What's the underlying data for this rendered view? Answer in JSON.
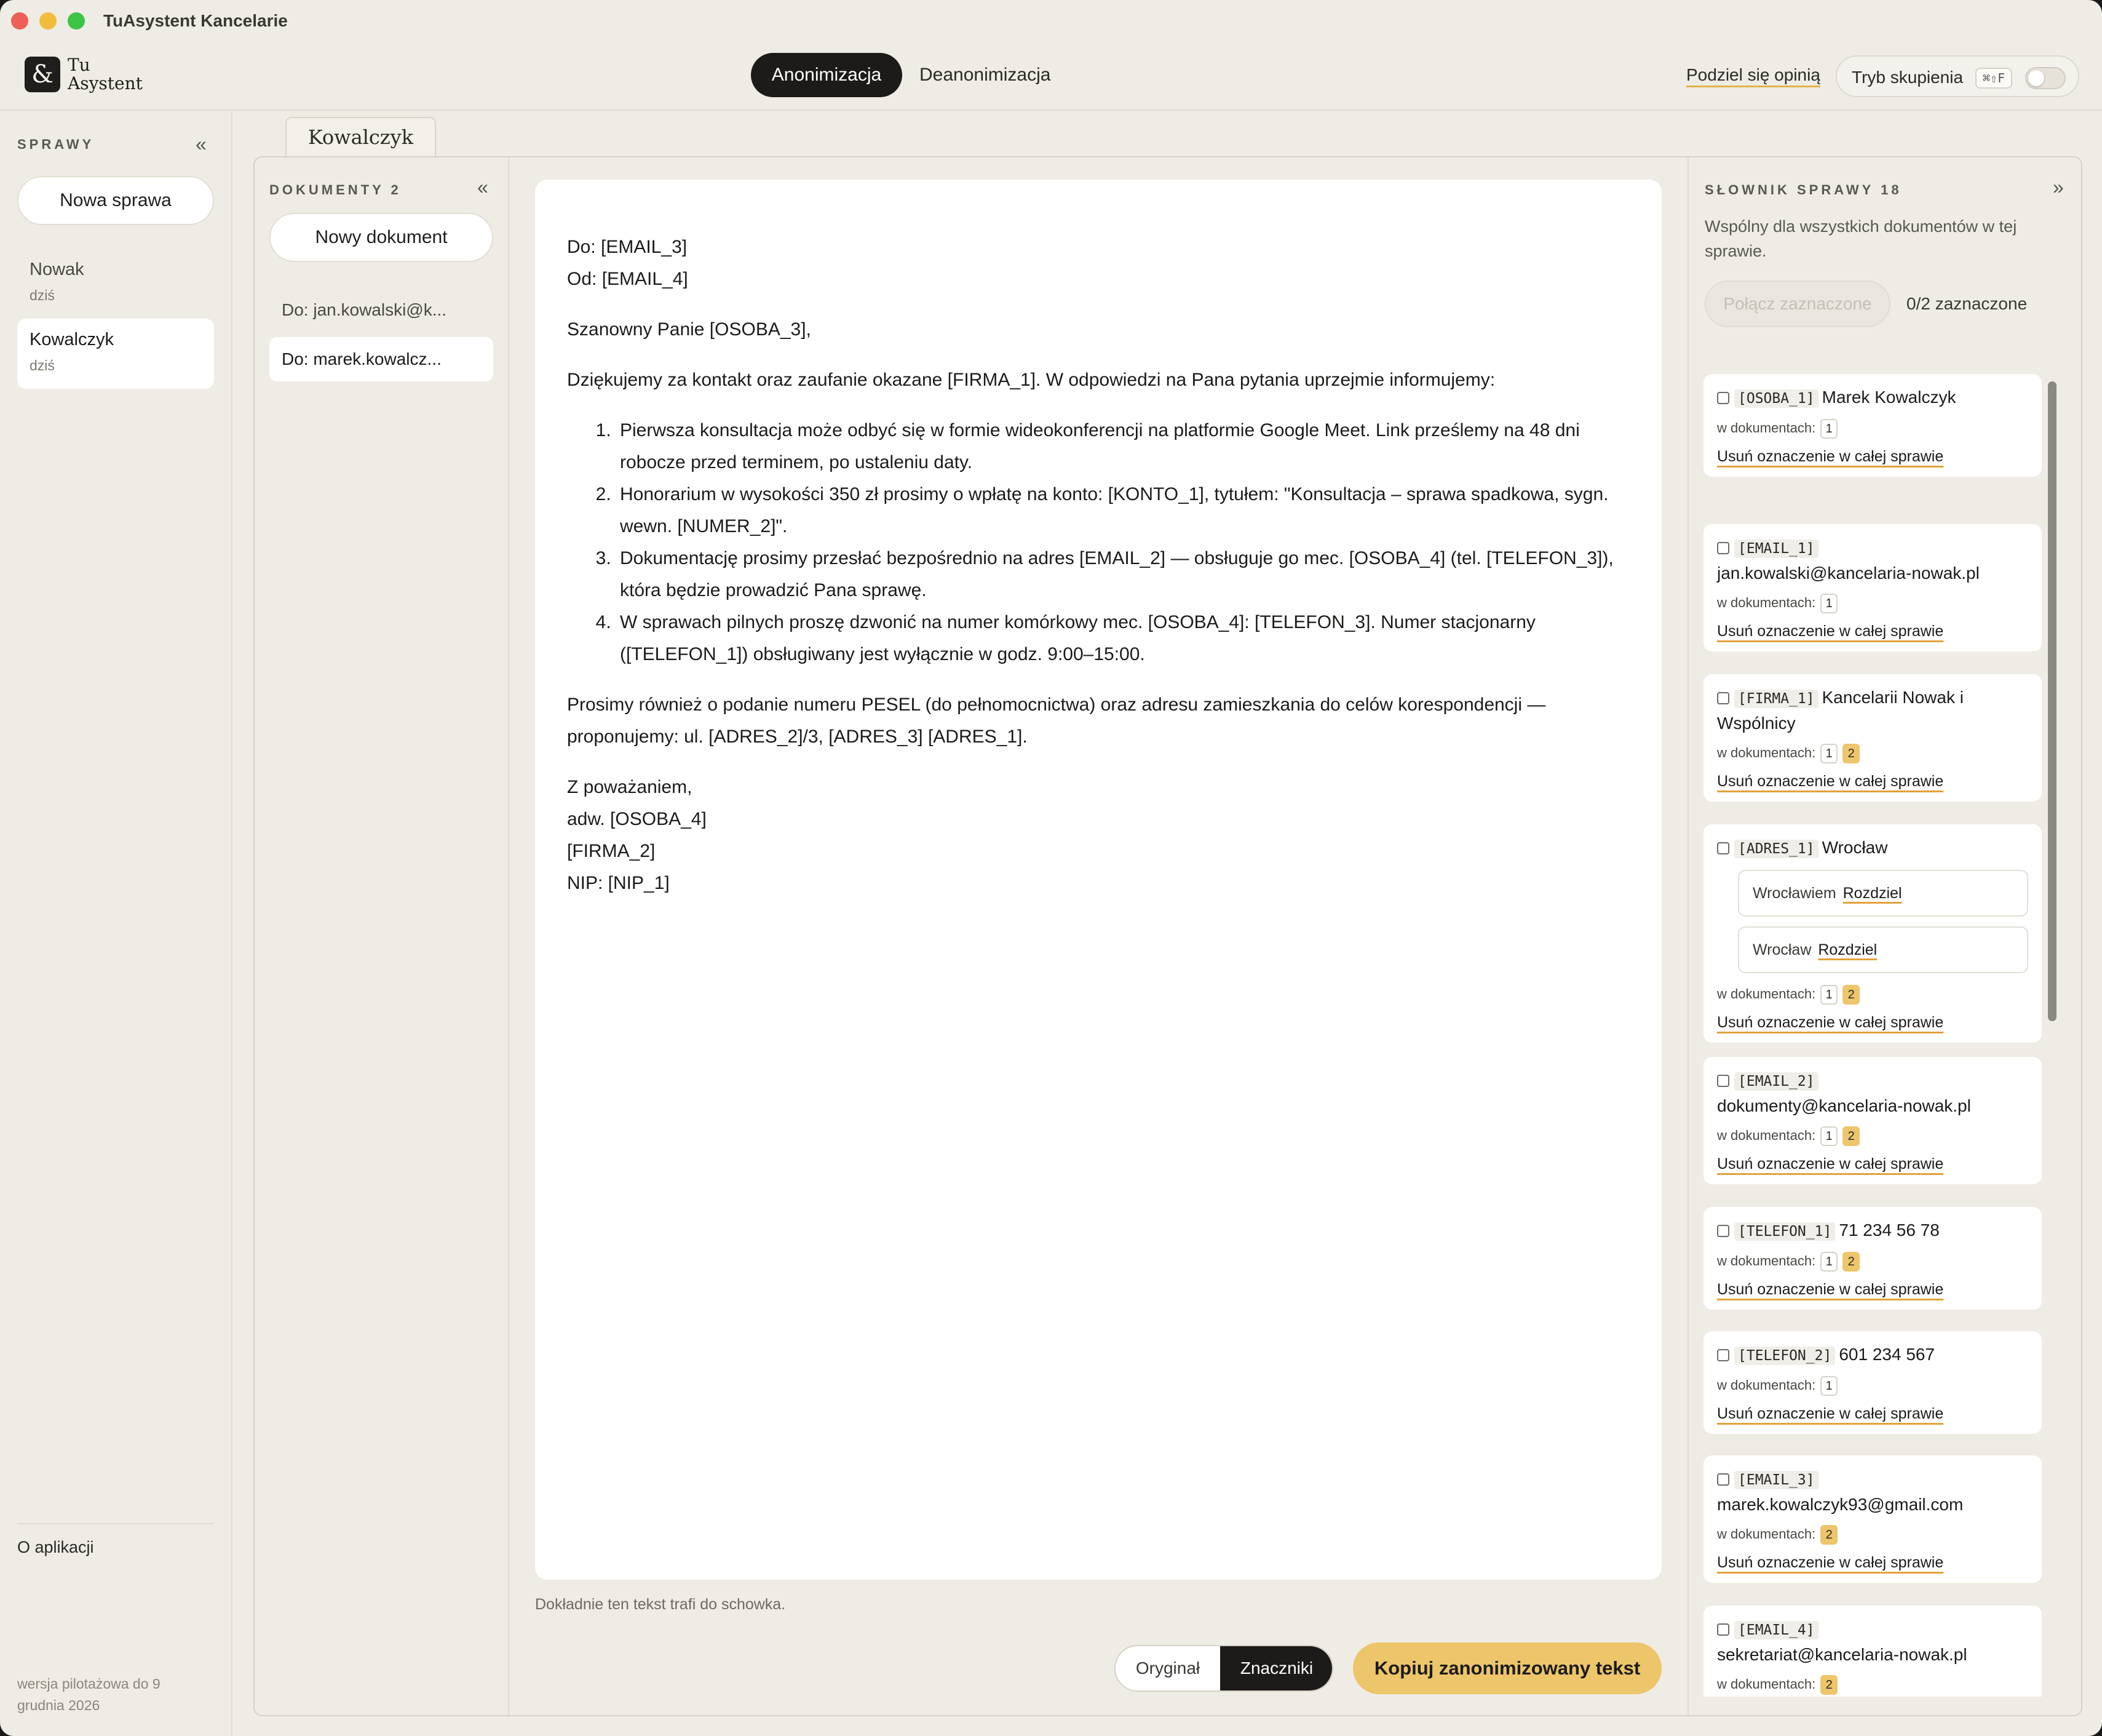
{
  "window": {
    "title": "TuAsystent Kancelarie"
  },
  "logo": {
    "mark": "&",
    "line1": "Tu",
    "line2": "Asystent"
  },
  "modes": {
    "active": "Anonimizacja",
    "inactive": "Deanonimizacja"
  },
  "header": {
    "feedback": "Podziel się opinią",
    "focus_label": "Tryb skupienia",
    "focus_shortcut": "⌘⇧F"
  },
  "sidebar": {
    "heading": "SPRAWY",
    "new_case": "Nowa sprawa",
    "cases": [
      {
        "name": "Nowak",
        "date": "dziś"
      },
      {
        "name": "Kowalczyk",
        "date": "dziś"
      }
    ],
    "about_title": "O aplikacji",
    "about_version": "wersja pilotażowa do 9 grudnia 2026"
  },
  "case_tab": "Kowalczyk",
  "documents": {
    "heading": "DOKUMENTY",
    "count": "2",
    "new_doc": "Nowy dokument",
    "items": [
      "Do: jan.kowalski@k...",
      "Do: marek.kowalcz..."
    ]
  },
  "editor": {
    "to": "Do: [EMAIL_3]",
    "from": "Od: [EMAIL_4]",
    "greeting": "Szanowny Panie [OSOBA_3],",
    "intro": "Dziękujemy za kontakt oraz zaufanie okazane [FIRMA_1]. W odpowiedzi na Pana pytania uprzejmie informujemy:",
    "list": [
      "Pierwsza konsultacja może odbyć się w formie wideokonferencji na platformie Google Meet. Link prześlemy na 48 dni robocze przed terminem, po ustaleniu daty.",
      "Honorarium w wysokości 350 zł prosimy o wpłatę na konto: [KONTO_1], tytułem: \"Konsultacja – sprawa spadkowa, sygn. wewn. [NUMER_2]\".",
      "Dokumentację prosimy przesłać bezpośrednio na adres [EMAIL_2] — obsługuje go mec. [OSOBA_4] (tel. [TELEFON_3]), która będzie prowadzić Pana sprawę.",
      "W sprawach pilnych proszę dzwonić na numer komórkowy mec. [OSOBA_4]: [TELEFON_3]. Numer stacjonarny ([TELEFON_1]) obsługiwany jest wyłącznie w godz. 9:00–15:00."
    ],
    "request": "Prosimy również o podanie numeru PESEL (do pełnomocnictwa) oraz adresu zamieszkania do celów korespondencji — proponujemy: ul. [ADRES_2]/3, [ADRES_3] [ADRES_1].",
    "closing": "Z poważaniem,",
    "sign1": "adw. [OSOBA_4]",
    "sign2": "[FIRMA_2]",
    "sign3": "NIP: [NIP_1]",
    "hint": "Dokładnie ten tekst trafi do schowka."
  },
  "view_toggle": {
    "original": "Oryginał",
    "markers": "Znaczniki",
    "selected": "Znaczniki"
  },
  "copy_button": "Kopiuj zanonimizowany tekst",
  "dictionary": {
    "heading": "SŁOWNIK SPRAWY",
    "count": "18",
    "description": "Wspólny dla wszystkich dokumentów w tej sprawie.",
    "merge_button": "Połącz zaznaczone",
    "selected_count": "0/2 zaznaczone",
    "in_docs_label": "w dokumentach:",
    "remove_label": "Usuń oznaczenie w całej sprawie",
    "split_label": "Rozdziel",
    "entries": [
      {
        "tag": "[OSOBA_1]",
        "value": "Marek Kowalczyk",
        "docs": [
          "1"
        ]
      },
      {
        "tag": "[EMAIL_1]",
        "value": "jan.kowalski@kancelaria-nowak.pl",
        "docs": [
          "1"
        ]
      },
      {
        "tag": "[FIRMA_1]",
        "value": "Kancelarii Nowak i Wspólnicy",
        "docs": [
          "1",
          "2"
        ]
      },
      {
        "tag": "[ADRES_1]",
        "value": "Wrocław",
        "variants": [
          "Wrocławiem",
          "Wrocław"
        ],
        "docs": [
          "1",
          "2"
        ]
      },
      {
        "tag": "[EMAIL_2]",
        "value": "dokumenty@kancelaria-nowak.pl",
        "docs": [
          "1",
          "2"
        ]
      },
      {
        "tag": "[TELEFON_1]",
        "value": "71 234 56 78",
        "docs": [
          "1",
          "2"
        ]
      },
      {
        "tag": "[TELEFON_2]",
        "value": "601 234 567",
        "docs": [
          "1"
        ]
      },
      {
        "tag": "[EMAIL_3]",
        "value": "marek.kowalczyk93@gmail.com",
        "docs": [
          "2"
        ]
      },
      {
        "tag": "[EMAIL_4]",
        "value": "sekretariat@kancelaria-nowak.pl",
        "docs": [
          "2"
        ]
      }
    ]
  }
}
